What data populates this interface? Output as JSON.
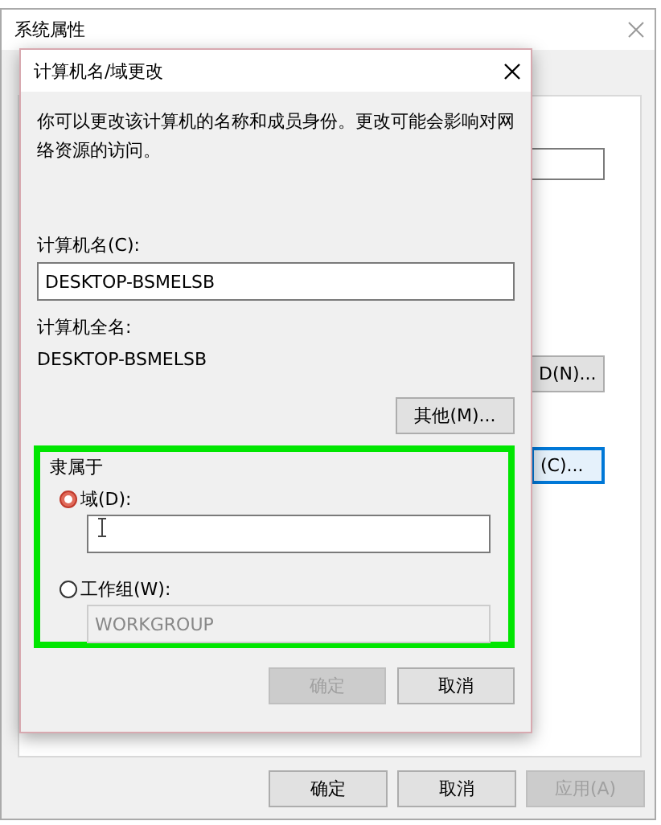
{
  "back_window": {
    "title": "系统属性",
    "partial_buttons": [
      {
        "label": "D(N)...",
        "focused": false
      },
      {
        "label": "(C)...",
        "focused": true
      }
    ],
    "buttons": [
      {
        "label": "确定",
        "disabled": false
      },
      {
        "label": "取消",
        "disabled": false
      },
      {
        "label": "应用(A)",
        "disabled": true
      }
    ]
  },
  "dialog": {
    "title": "计算机名/域更改",
    "description": "你可以更改该计算机的名称和成员身份。更改可能会影响对网络资源的访问。",
    "computer_name_label": "计算机名(C):",
    "computer_name_value": "DESKTOP-BSMELSB",
    "full_name_label": "计算机全名:",
    "full_name": "DESKTOP-BSMELSB",
    "more_button": "其他(M)...",
    "member_of": {
      "label": "隶属于",
      "options": [
        {
          "label": "域(D):",
          "selected": true,
          "field": {
            "disabled": false
          }
        },
        {
          "label": "工作组(W):",
          "selected": false,
          "field": {
            "value": "WORKGROUP",
            "disabled": true
          }
        }
      ]
    },
    "buttons": [
      {
        "label": "确定",
        "disabled": true
      },
      {
        "label": "取消",
        "disabled": false
      }
    ]
  }
}
